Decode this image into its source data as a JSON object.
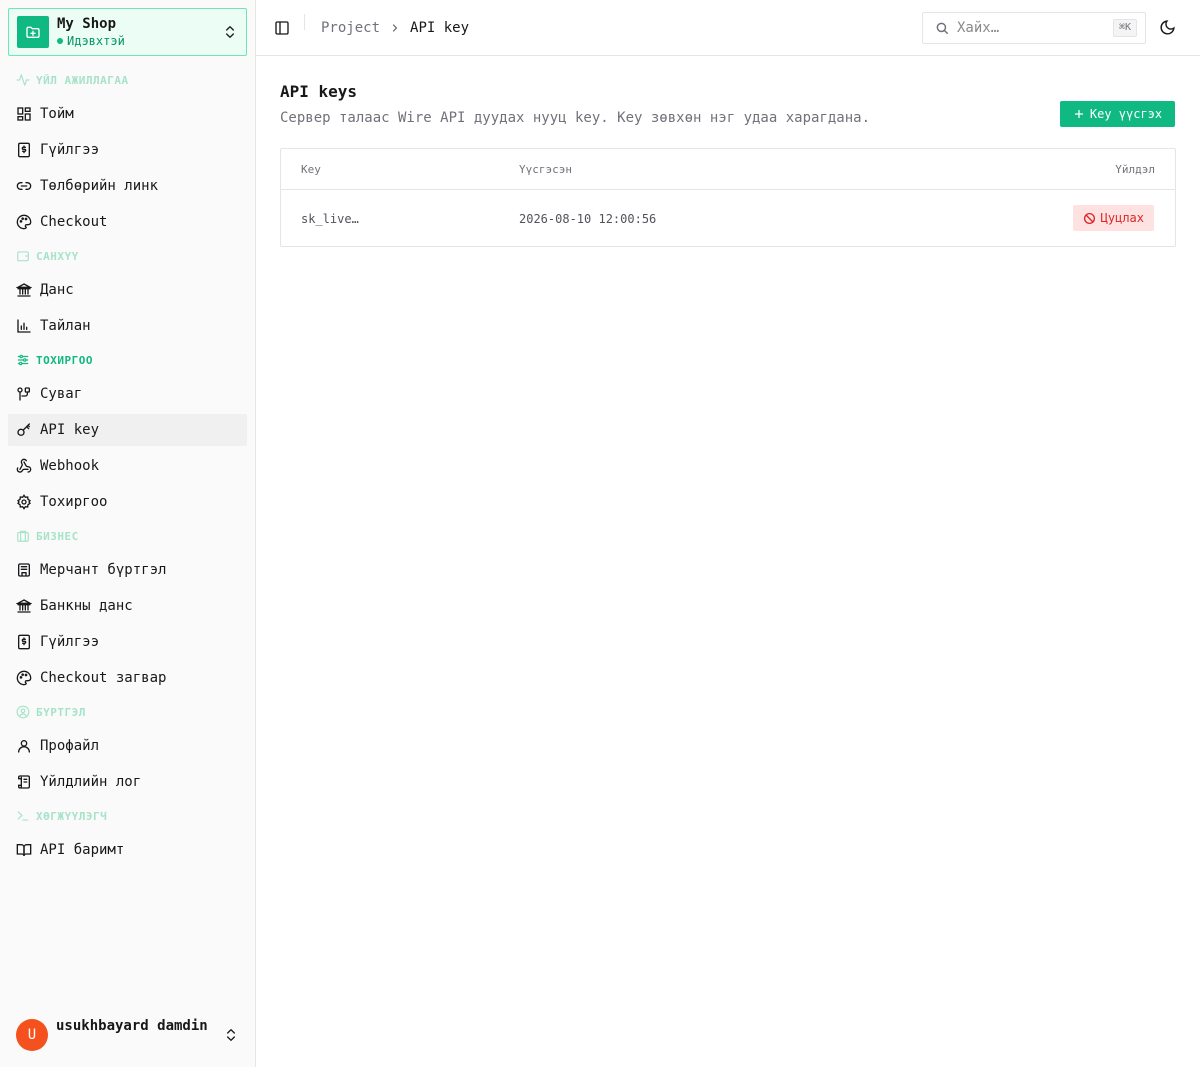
{
  "app": {
    "shop_name": "My Shop",
    "shop_status": "Идэвхтэй"
  },
  "sidebar": {
    "sections": [
      {
        "label": "ҮЙЛ АЖИЛЛАГАА",
        "icon": "activity-icon"
      },
      {
        "label": "САНХҮҮ",
        "icon": "wallet-icon"
      },
      {
        "label": "ТОХИРГОО",
        "icon": "sliders-icon"
      },
      {
        "label": "БИЗНЕС",
        "icon": "briefcase-icon"
      },
      {
        "label": "БҮРТГЭЛ",
        "icon": "user-circle-icon"
      },
      {
        "label": "ХӨГЖҮҮЛЭГЧ",
        "icon": "terminal-icon"
      }
    ],
    "items": [
      {
        "label": "Тойм",
        "icon": "dashboard-icon"
      },
      {
        "label": "Гүйлгээ",
        "icon": "receipt-icon"
      },
      {
        "label": "Төлбөрийн линк",
        "icon": "link-icon"
      },
      {
        "label": "Checkout",
        "icon": "palette-icon"
      },
      {
        "label": "Данс",
        "icon": "bank-icon"
      },
      {
        "label": "Тайлан",
        "icon": "bar-chart-icon"
      },
      {
        "label": "Суваг",
        "icon": "channels-icon"
      },
      {
        "label": "API key",
        "icon": "key-icon"
      },
      {
        "label": "Webhook",
        "icon": "webhook-icon"
      },
      {
        "label": "Тохиргоо",
        "icon": "gear-icon"
      },
      {
        "label": "Мерчант бүртгэл",
        "icon": "store-icon"
      },
      {
        "label": "Банкны данс",
        "icon": "bank-icon"
      },
      {
        "label": "Гүйлгээ",
        "icon": "receipt-icon"
      },
      {
        "label": "Checkout загвар",
        "icon": "palette-icon"
      },
      {
        "label": "Профайл",
        "icon": "user-icon"
      },
      {
        "label": "Үйлдлийн лог",
        "icon": "scroll-icon"
      },
      {
        "label": "API баримт",
        "icon": "book-icon"
      }
    ],
    "active_item": "API key"
  },
  "user": {
    "initial": "U",
    "name": "usukhbayard damdin"
  },
  "header": {
    "breadcrumb_parent": "Project",
    "breadcrumb_current": "API key",
    "search_placeholder": "Хайх…",
    "search_shortcut": "⌘K"
  },
  "main": {
    "title": "API keys",
    "description": "Сервер талаас Wire API дуудах нууц key. Key зөвхөн нэг удаа харагдана.",
    "create_button": "Key үүсгэх",
    "table": {
      "columns": [
        "Key",
        "Үүсгэсэн",
        "Үйлдэл"
      ],
      "rows": [
        {
          "key": "sk_live…",
          "created": "2026-08-10 12:00:56",
          "action": "Цуцлах"
        }
      ]
    }
  },
  "colors": {
    "accent": "#10b981",
    "danger": "#dc2626",
    "avatar": "#f4511e"
  }
}
